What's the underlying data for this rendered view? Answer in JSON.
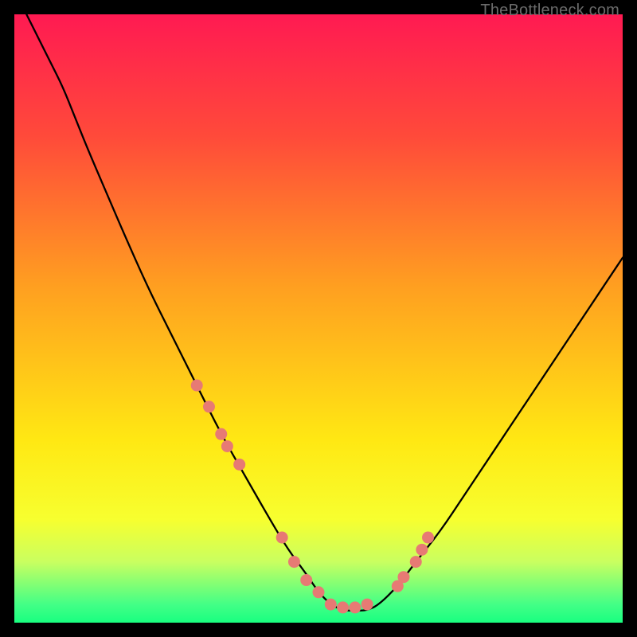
{
  "watermark": "TheBottleneck.com",
  "chart_data": {
    "type": "line",
    "title": "",
    "xlabel": "",
    "ylabel": "",
    "xlim": [
      0,
      100
    ],
    "ylim": [
      0,
      100
    ],
    "grid": false,
    "legend": false,
    "background_gradient": {
      "stops": [
        {
          "offset": 0.0,
          "color": "#ff1a52"
        },
        {
          "offset": 0.2,
          "color": "#ff4a3a"
        },
        {
          "offset": 0.45,
          "color": "#ffa020"
        },
        {
          "offset": 0.7,
          "color": "#ffe813"
        },
        {
          "offset": 0.83,
          "color": "#f7ff2f"
        },
        {
          "offset": 0.9,
          "color": "#c9ff60"
        },
        {
          "offset": 0.97,
          "color": "#43ff86"
        },
        {
          "offset": 1.0,
          "color": "#19ff80"
        }
      ]
    },
    "series": [
      {
        "name": "bottleneck-curve",
        "color": "#000000",
        "x": [
          2,
          4,
          6,
          8,
          10,
          12,
          15,
          18,
          22,
          26,
          30,
          34,
          38,
          42,
          45,
          48,
          50,
          52,
          54,
          56,
          58,
          60,
          63,
          66,
          70,
          74,
          78,
          82,
          86,
          90,
          94,
          98,
          100
        ],
        "y": [
          100,
          96,
          92,
          88,
          83,
          78,
          71,
          64,
          55,
          47,
          39,
          31,
          24,
          17,
          12,
          8,
          5,
          3,
          2,
          2,
          2,
          3,
          6,
          10,
          15,
          21,
          27,
          33,
          39,
          45,
          51,
          57,
          60
        ]
      },
      {
        "name": "highlight-dots",
        "color": "#e77a74",
        "type": "scatter",
        "x": [
          30,
          32,
          34,
          35,
          37,
          44,
          46,
          48,
          50,
          52,
          54,
          56,
          58,
          63,
          64,
          66,
          67,
          68
        ],
        "y": [
          39,
          35.5,
          31,
          29,
          26,
          14,
          10,
          7,
          5,
          3,
          2.5,
          2.5,
          3,
          6,
          7.5,
          10,
          12,
          14
        ]
      }
    ]
  }
}
